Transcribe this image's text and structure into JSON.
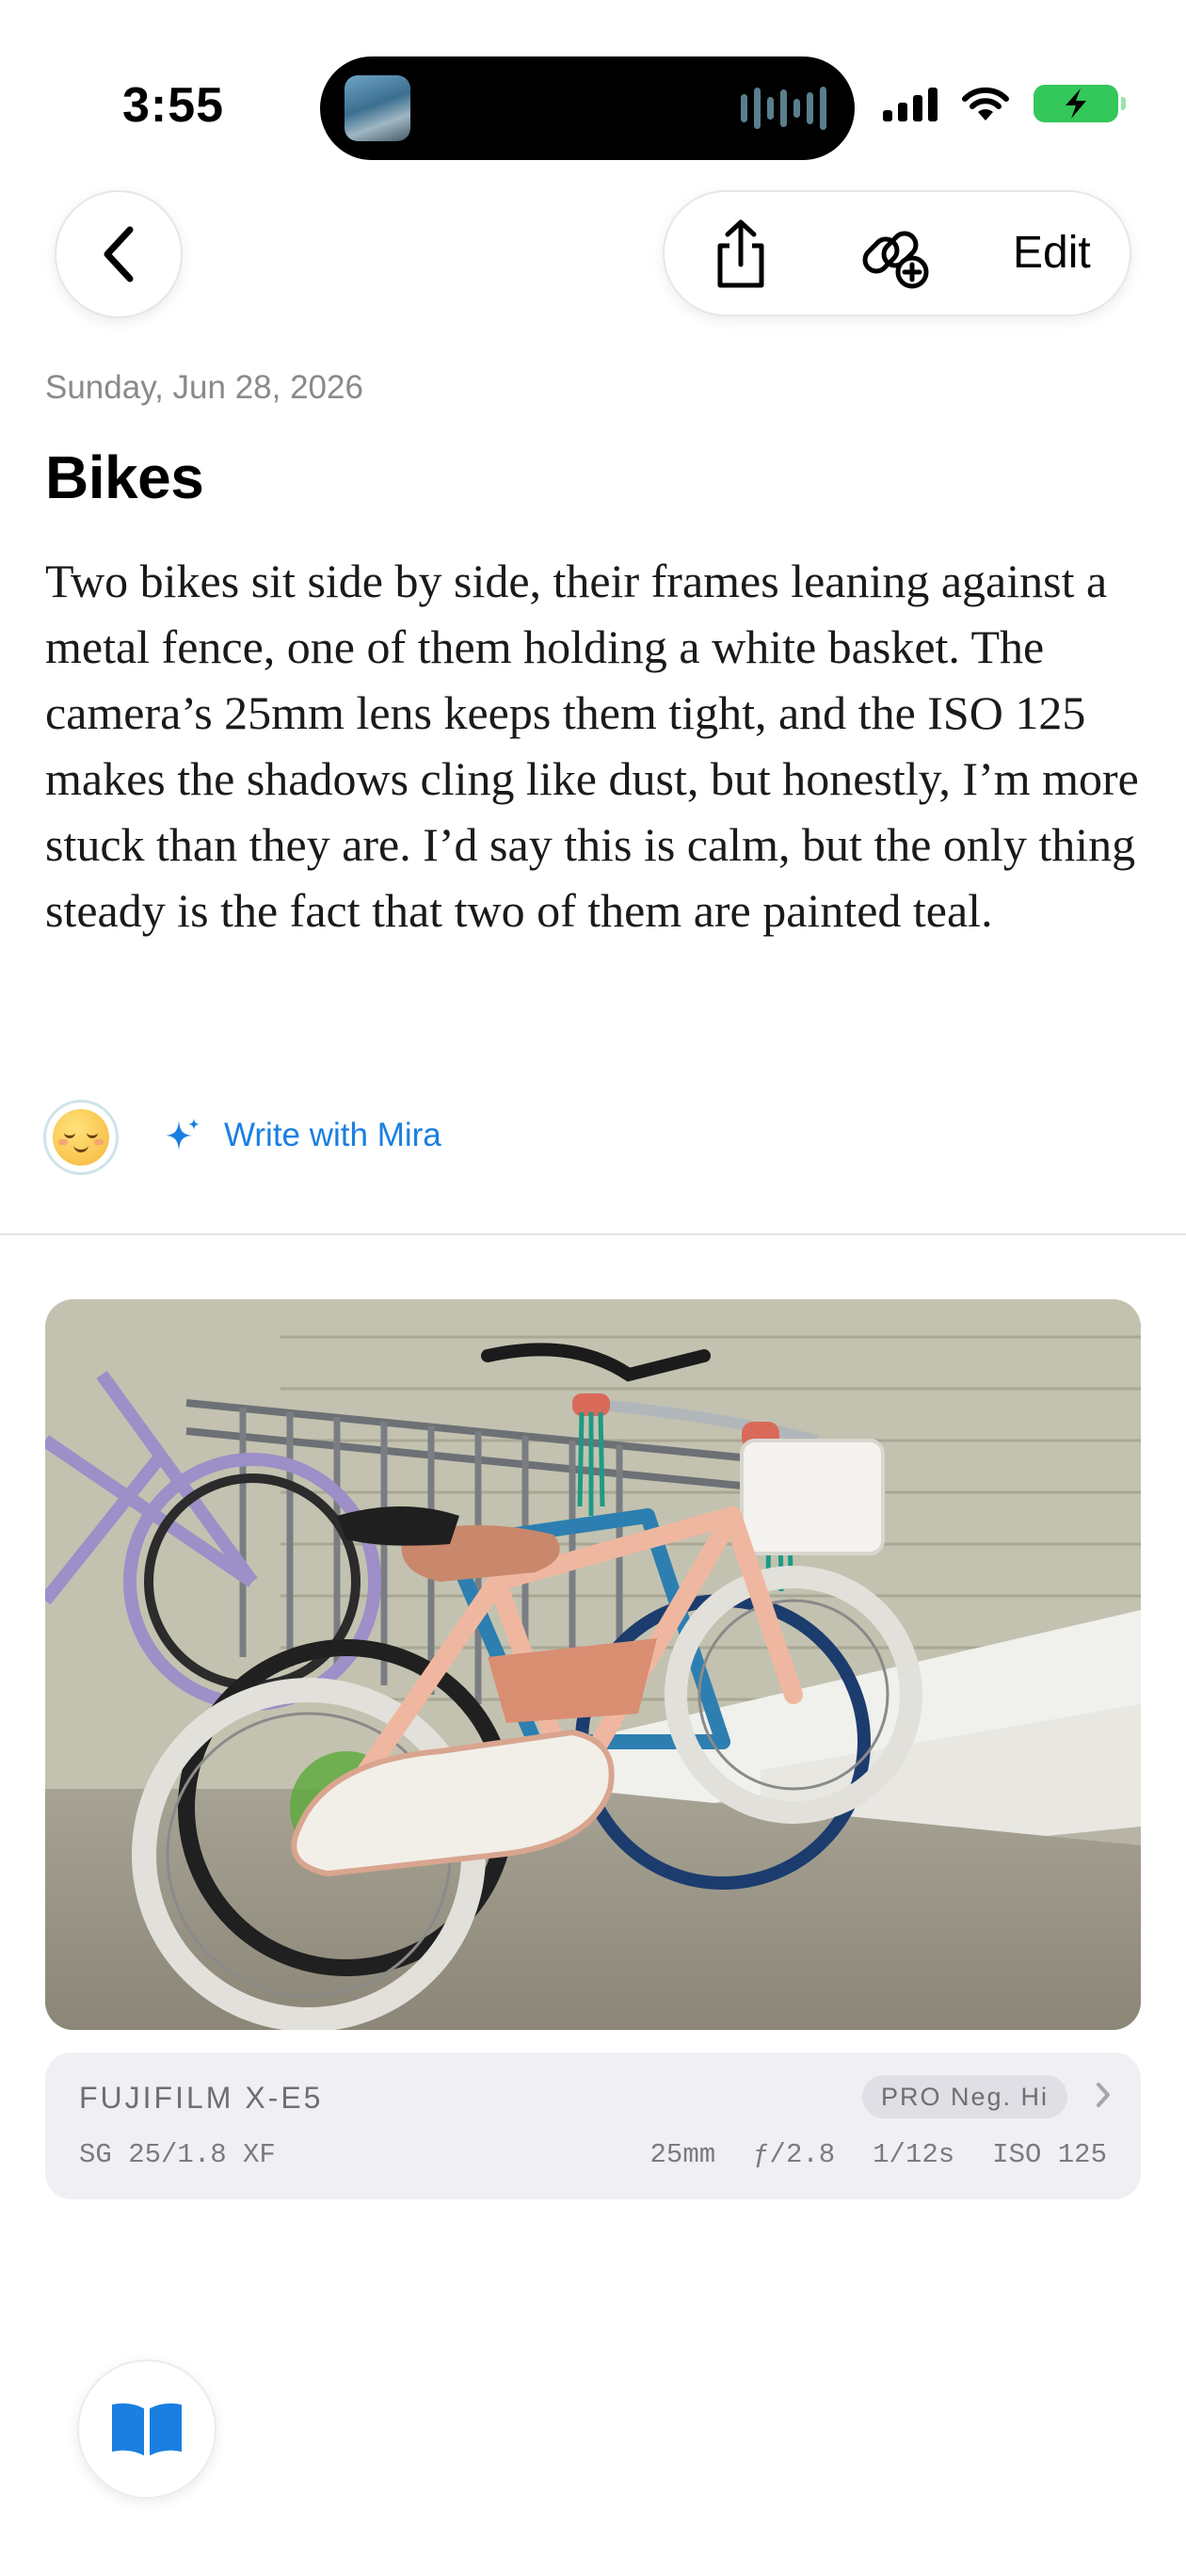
{
  "status_bar": {
    "time": "3:55"
  },
  "nav": {
    "edit_label": "Edit"
  },
  "entry": {
    "date": "Sunday, Jun 28, 2026",
    "title": "Bikes",
    "body": "Two bikes sit side by side, their frames leaning against a metal fence, one of them holding a white basket. The camera’s 25mm lens keeps them tight, and the ISO 125 makes the shadows cling like dust, but honestly, I’m more stuck than they are. I’d say this is calm, but the only thing steady is the fact that two of them are painted teal."
  },
  "mood": {
    "icon": "relieved-face-icon"
  },
  "assistant": {
    "label": "Write with Mira",
    "color": "#1a7fe0"
  },
  "photo": {
    "subject": "bikes-photo"
  },
  "exif": {
    "camera": "FUJIFILM X-E5",
    "lens": "SG 25/1.8 XF",
    "film_simulation": "PRO Neg. Hi",
    "focal_length": "25mm",
    "aperture": "ƒ/2.8",
    "shutter": "1/12s",
    "iso": "ISO 125"
  }
}
